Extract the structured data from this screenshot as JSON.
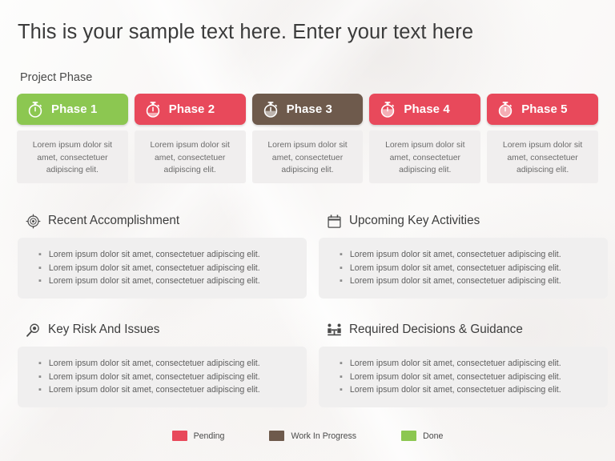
{
  "slide": {
    "title": "This is your sample text here. Enter your text here",
    "project_phase_label": "Project Phase"
  },
  "phases": [
    {
      "name": "Phase 1",
      "icon": "stopwatch-icon",
      "color": "#8CC751",
      "fill_pct": 0,
      "description": "Lorem ipsum dolor sit amet, consectetuer adipiscing elit."
    },
    {
      "name": "Phase 2",
      "icon": "stopwatch-icon",
      "color": "#E8495B",
      "fill_pct": 35,
      "description": "Lorem ipsum dolor sit amet, consectetuer adipiscing elit."
    },
    {
      "name": "Phase 3",
      "icon": "stopwatch-icon",
      "color": "#6E5A4C",
      "fill_pct": 50,
      "description": "Lorem ipsum dolor sit amet, consectetuer adipiscing elit."
    },
    {
      "name": "Phase 4",
      "icon": "stopwatch-icon",
      "color": "#E8495B",
      "fill_pct": 65,
      "description": "Lorem ipsum dolor sit amet, consectetuer adipiscing elit."
    },
    {
      "name": "Phase 5",
      "icon": "stopwatch-icon",
      "color": "#E8495B",
      "fill_pct": 88,
      "description": "Lorem ipsum dolor sit amet, consectetuer adipiscing elit."
    }
  ],
  "sections": [
    {
      "title": "Recent Accomplishment",
      "icon": "target-icon",
      "bullets": [
        "Lorem ipsum dolor sit amet, consectetuer adipiscing elit.",
        "Lorem ipsum dolor sit amet, consectetuer adipiscing elit.",
        "Lorem ipsum dolor sit amet, consectetuer adipiscing elit."
      ]
    },
    {
      "title": "Upcoming Key Activities",
      "icon": "calendar-icon",
      "bullets": [
        "Lorem ipsum dolor sit amet, consectetuer adipiscing elit.",
        "Lorem ipsum dolor sit amet, consectetuer adipiscing elit.",
        "Lorem ipsum dolor sit amet, consectetuer adipiscing elit."
      ]
    },
    {
      "title": "Key Risk And Issues",
      "icon": "magnifier-icon",
      "bullets": [
        "Lorem ipsum dolor sit amet, consectetuer adipiscing elit.",
        "Lorem ipsum dolor sit amet, consectetuer adipiscing elit.",
        "Lorem ipsum dolor sit amet, consectetuer adipiscing elit."
      ]
    },
    {
      "title": "Required Decisions & Guidance",
      "icon": "meeting-icon",
      "bullets": [
        "Lorem ipsum dolor sit amet, consectetuer adipiscing elit.",
        "Lorem ipsum dolor sit amet, consectetuer adipiscing elit.",
        "Lorem ipsum dolor sit amet, consectetuer adipiscing elit."
      ]
    }
  ],
  "legend": [
    {
      "label": "Pending",
      "color": "#E8495B"
    },
    {
      "label": "Work In Progress",
      "color": "#6E5A4C"
    },
    {
      "label": "Done",
      "color": "#8CC751"
    }
  ]
}
